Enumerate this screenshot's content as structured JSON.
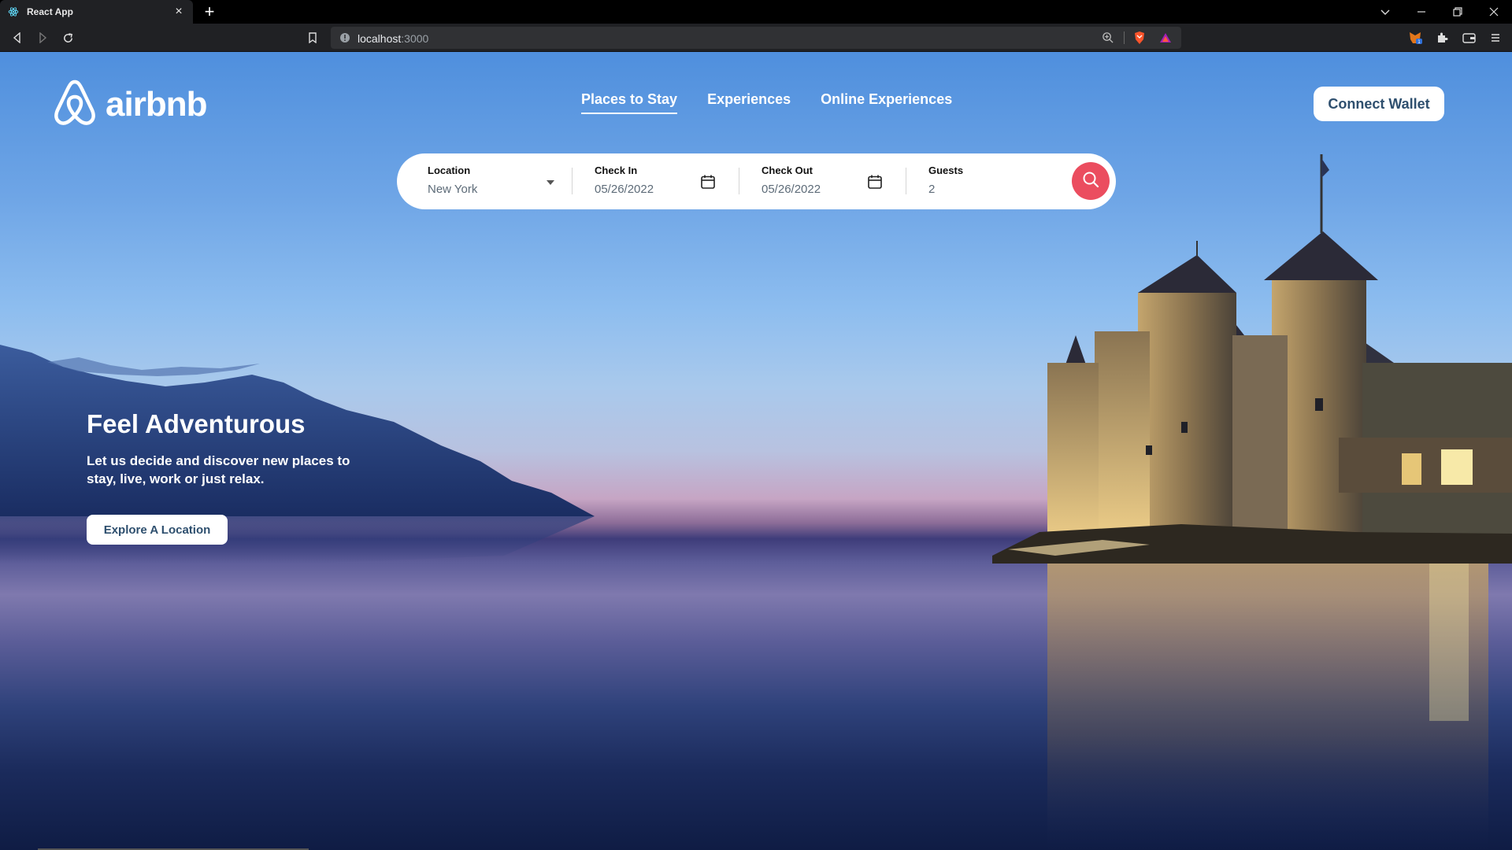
{
  "browser": {
    "tab_title": "React App",
    "tab_close": "×",
    "new_tab": "+",
    "url_host": "localhost",
    "url_port": ":3000"
  },
  "header": {
    "logo_text": "airbnb",
    "nav": [
      {
        "label": "Places to Stay",
        "active": true
      },
      {
        "label": "Experiences",
        "active": false
      },
      {
        "label": "Online Experiences",
        "active": false
      }
    ],
    "connect_label": "Connect Wallet"
  },
  "search": {
    "location": {
      "label": "Location",
      "value": "New York"
    },
    "check_in": {
      "label": "Check In",
      "value": "05/26/2022"
    },
    "check_out": {
      "label": "Check Out",
      "value": "05/26/2022"
    },
    "guests": {
      "label": "Guests",
      "value": "2"
    }
  },
  "hero": {
    "title": "Feel Adventurous",
    "subtitle": "Let us decide and discover new places to stay, live, work or just relax.",
    "button_label": "Explore A Location"
  },
  "colors": {
    "search_button": "#eb4d5f",
    "button_text": "#2e4f6e"
  }
}
